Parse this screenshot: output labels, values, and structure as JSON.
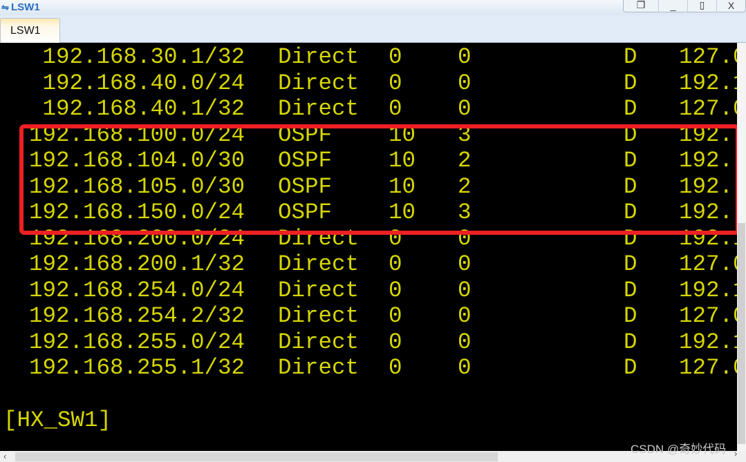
{
  "window": {
    "title": "LSW1",
    "controls": [
      "restore",
      "minimize",
      "maximize",
      "close"
    ],
    "close_label": "X"
  },
  "tabs": [
    {
      "label": "LSW1",
      "active": true
    }
  ],
  "terminal": {
    "text_color": "#d6d600",
    "routes": [
      {
        "dest": " 192.168.30.1/32",
        "proto": "Direct",
        "pre": "0",
        "cost": "0",
        "flags": "D",
        "nexthop": "127.0"
      },
      {
        "dest": " 192.168.40.0/24",
        "proto": "Direct",
        "pre": "0",
        "cost": "0",
        "flags": "D",
        "nexthop": "192.1"
      },
      {
        "dest": " 192.168.40.1/32",
        "proto": "Direct",
        "pre": "0",
        "cost": "0",
        "flags": "D",
        "nexthop": "127.0"
      },
      {
        "dest": "192.168.100.0/24",
        "proto": "OSPF",
        "pre": "10",
        "cost": "3",
        "flags": "D",
        "nexthop": "192."
      },
      {
        "dest": "192.168.104.0/30",
        "proto": "OSPF",
        "pre": "10",
        "cost": "2",
        "flags": "D",
        "nexthop": "192."
      },
      {
        "dest": "192.168.105.0/30",
        "proto": "OSPF",
        "pre": "10",
        "cost": "2",
        "flags": "D",
        "nexthop": "192."
      },
      {
        "dest": "192.168.150.0/24",
        "proto": "OSPF",
        "pre": "10",
        "cost": "3",
        "flags": "D",
        "nexthop": "192."
      },
      {
        "dest": "192.168.200.0/24",
        "proto": "Direct",
        "pre": "0",
        "cost": "0",
        "flags": "D",
        "nexthop": "192.1"
      },
      {
        "dest": "192.168.200.1/32",
        "proto": "Direct",
        "pre": "0",
        "cost": "0",
        "flags": "D",
        "nexthop": "127.0"
      },
      {
        "dest": "192.168.254.0/24",
        "proto": "Direct",
        "pre": "0",
        "cost": "0",
        "flags": "D",
        "nexthop": "192.1"
      },
      {
        "dest": "192.168.254.2/32",
        "proto": "Direct",
        "pre": "0",
        "cost": "0",
        "flags": "D",
        "nexthop": "127.0"
      },
      {
        "dest": "192.168.255.0/24",
        "proto": "Direct",
        "pre": "0",
        "cost": "0",
        "flags": "D",
        "nexthop": "192.1"
      },
      {
        "dest": "192.168.255.1/32",
        "proto": "Direct",
        "pre": "0",
        "cost": "0",
        "flags": "D",
        "nexthop": "127.0"
      }
    ],
    "prompt": "[HX_SW1]",
    "highlight_color": "#ee2024"
  },
  "watermark": "CSDN @奇妙代码"
}
